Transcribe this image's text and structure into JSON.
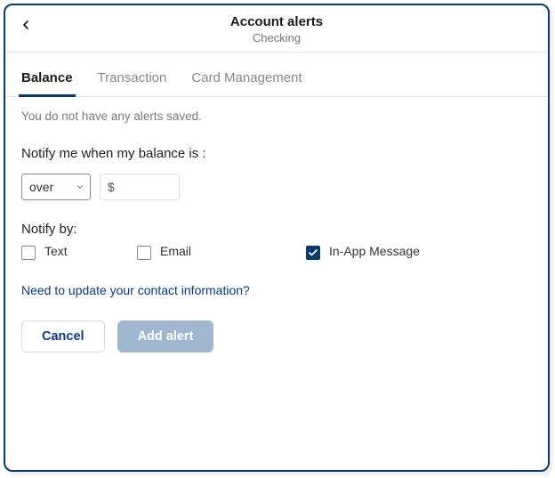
{
  "header": {
    "title": "Account alerts",
    "subtitle": "Checking"
  },
  "tabs": [
    {
      "label": "Balance",
      "active": true
    },
    {
      "label": "Transaction",
      "active": false
    },
    {
      "label": "Card Management",
      "active": false
    }
  ],
  "empty_message": "You do not have any alerts saved.",
  "balance_form": {
    "condition_label": "Notify me when my balance is :",
    "comparison_selected": "over",
    "amount_prefix": "$",
    "amount_value": ""
  },
  "notify_by": {
    "label": "Notify by:",
    "options": [
      {
        "key": "text",
        "label": "Text",
        "checked": false
      },
      {
        "key": "email",
        "label": "Email",
        "checked": false
      },
      {
        "key": "inapp",
        "label": "In-App Message",
        "checked": true
      }
    ]
  },
  "contact_link": "Need to update your contact information?",
  "buttons": {
    "cancel": "Cancel",
    "add": "Add alert"
  },
  "icons": {
    "back": "chevron-left-icon",
    "caret": "chevron-down-icon",
    "check": "checkmark-icon"
  }
}
